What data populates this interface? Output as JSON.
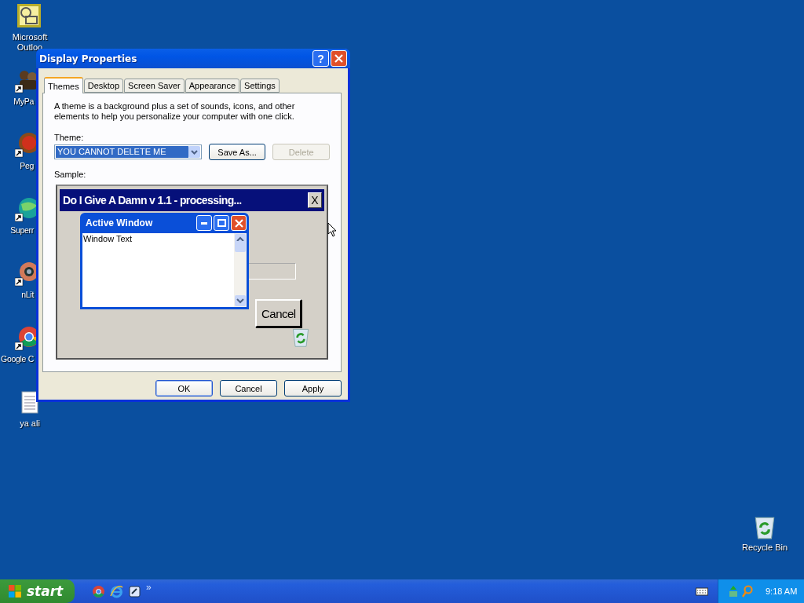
{
  "desktop_icons": [
    {
      "kind": "outlook",
      "label": "Microsoft Outloo",
      "clipped": false,
      "shortcut": false
    },
    {
      "kind": "figures",
      "label": "MyPa",
      "clipped": true,
      "shortcut": true
    },
    {
      "kind": "ball",
      "label": "Peg",
      "clipped": true,
      "shortcut": true
    },
    {
      "kind": "globe",
      "label": "Superr",
      "clipped": true,
      "shortcut": true
    },
    {
      "kind": "gear",
      "label": "nLit",
      "clipped": true,
      "shortcut": true
    },
    {
      "kind": "chrome",
      "label": "Google C",
      "clipped": true,
      "shortcut": true
    },
    {
      "kind": "notepad",
      "label": "ya ali",
      "clipped": false,
      "shortcut": false
    }
  ],
  "recycle_bin": {
    "label": "Recycle Bin"
  },
  "dialog": {
    "title": "Display Properties",
    "help_button": "?",
    "tabs": [
      {
        "label": "Themes",
        "selected": true
      },
      {
        "label": "Desktop",
        "selected": false
      },
      {
        "label": "Screen Saver",
        "selected": false
      },
      {
        "label": "Appearance",
        "selected": false
      },
      {
        "label": "Settings",
        "selected": false
      }
    ],
    "description": "A theme is a background plus a set of sounds, icons, and other elements to help you personalize your computer with one click.",
    "theme_label": "Theme:",
    "theme_select": {
      "value": "YOU CANNOT DELETE ME"
    },
    "theme_buttons": [
      {
        "label": "Save As...",
        "disabled": false
      },
      {
        "label": "Delete",
        "disabled": true
      }
    ],
    "sample_label": "Sample:",
    "sample": {
      "app_title": "Do I Give A Damn v 1.1 - processing...",
      "app_close": "X",
      "active_window_title": "Active Window",
      "window_text": "Window Text",
      "cancel_label": "Cancel"
    },
    "buttons": [
      {
        "label": "OK",
        "default": true
      },
      {
        "label": "Cancel",
        "default": false
      },
      {
        "label": "Apply",
        "default": false
      }
    ]
  },
  "taskbar": {
    "start_label": "start",
    "chevron": "»",
    "clock": "9:18 AM"
  }
}
